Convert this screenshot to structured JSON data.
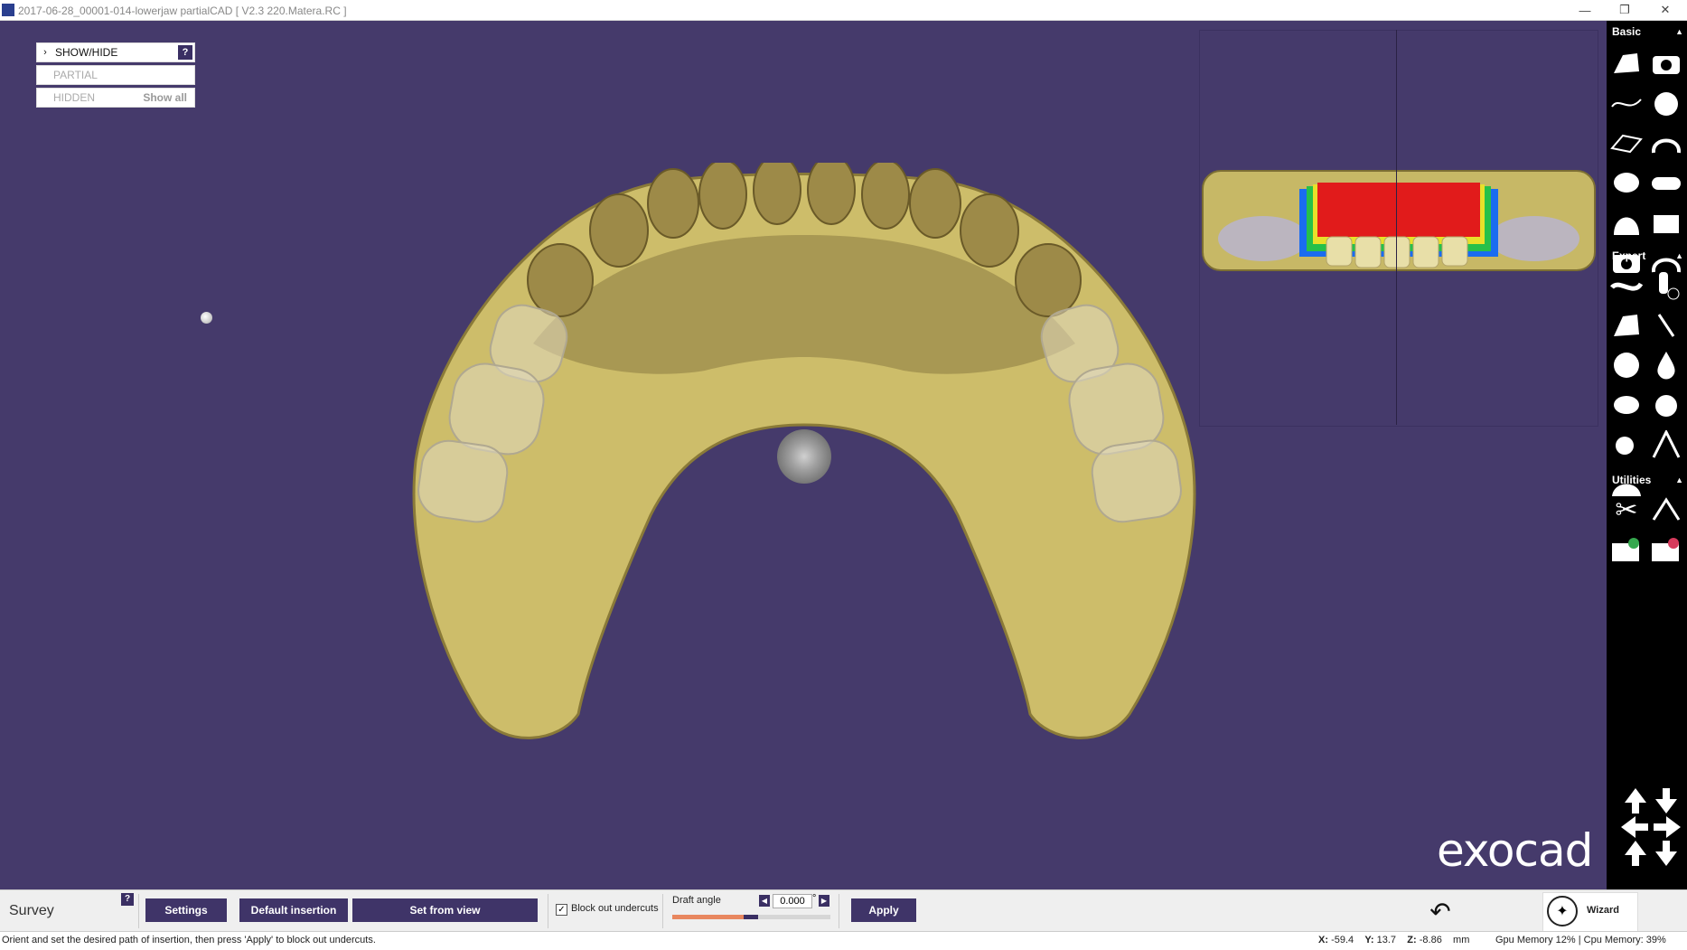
{
  "window": {
    "title": "2017-06-28_00001-014-lowerjaw partialCAD [ V2.3 220.Matera.RC ]",
    "minimize": "—",
    "restore": "❐",
    "close": "✕"
  },
  "show_hide_panel": {
    "header": "SHOW/HIDE",
    "help": "?",
    "partial": "PARTIAL",
    "hidden": "HIDDEN",
    "show_all": "Show all"
  },
  "brand": {
    "logo": "exocad"
  },
  "toolbar": {
    "basic": "Basic",
    "expert": "Expert",
    "utilities": "Utilities"
  },
  "bottom": {
    "mode_label": "Survey",
    "help": "?",
    "settings": "Settings",
    "default_insertion": "Default insertion",
    "set_from_view": "Set from view",
    "block_out_undercuts": "Block out undercuts",
    "block_out_checked": true,
    "draft_angle_label": "Draft angle",
    "draft_angle_value": "0.000",
    "draft_angle_unit": "°",
    "draft_slider_fraction": 0.45,
    "apply": "Apply",
    "wizard": "Wizard"
  },
  "status": {
    "message": "Orient and set the desired path of insertion, then press 'Apply' to block out undercuts.",
    "x_label": "X:",
    "x": "-59.4",
    "y_label": "Y:",
    "y": "13.7",
    "z_label": "Z:",
    "z": "-8.86",
    "unit": "mm",
    "gpu_memory": "Gpu Memory 12%",
    "cpu_memory": "Cpu Memory: 39%"
  },
  "colors": {
    "viewport_bg": "#453a6b",
    "model": "#cfbf6c",
    "accent": "#3f3468"
  }
}
